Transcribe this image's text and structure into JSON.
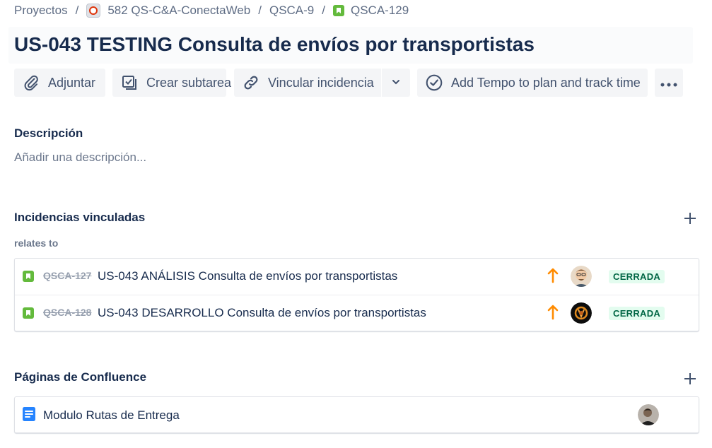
{
  "breadcrumb": {
    "items": [
      {
        "label": "Proyectos"
      },
      {
        "label": "582 QS-C&A-ConectaWeb"
      },
      {
        "label": "QSCA-9"
      },
      {
        "label": "QSCA-129"
      }
    ],
    "separator": "/"
  },
  "issue": {
    "title": "US-043 TESTING Consulta de envíos por transportistas"
  },
  "toolbar": {
    "attach_label": "Adjuntar",
    "subtask_label": "Crear subtarea",
    "link_label": "Vincular incidencia",
    "tempo_label": "Add Tempo to plan and track time"
  },
  "description": {
    "heading": "Descripción",
    "placeholder": "Añadir una descripción..."
  },
  "linked_issues": {
    "heading": "Incidencias vinculadas",
    "relation": "relates to",
    "items": [
      {
        "key": "QSCA-127",
        "summary": "US-043 ANÁLISIS Consulta de envíos por transportistas",
        "status": "CERRADA",
        "priority": "high"
      },
      {
        "key": "QSCA-128",
        "summary": "US-043 DESARROLLO Consulta de envíos por transportistas",
        "status": "CERRADA",
        "priority": "high"
      }
    ]
  },
  "confluence": {
    "heading": "Páginas de Confluence",
    "items": [
      {
        "title": "Modulo Rutas de Entrega"
      }
    ]
  },
  "colors": {
    "story_green": "#63ba3c",
    "priority_orange": "#ff7452",
    "status_done_bg": "#e3fcef",
    "status_done_text": "#006644",
    "doc_blue": "#2684ff"
  }
}
